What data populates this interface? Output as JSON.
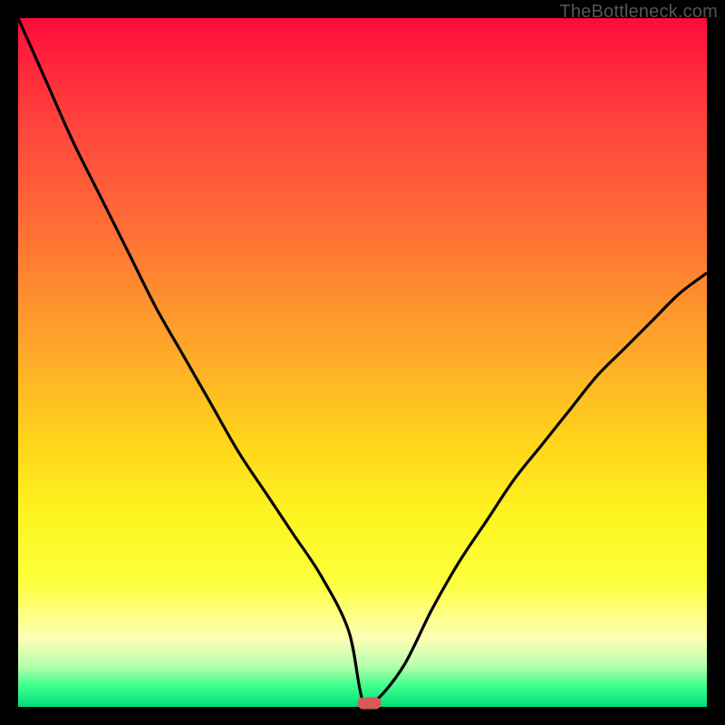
{
  "watermark": "TheBottleneck.com",
  "chart_data": {
    "type": "line",
    "title": "",
    "xlabel": "",
    "ylabel": "",
    "xlim": [
      0,
      100
    ],
    "ylim": [
      0,
      100
    ],
    "x": [
      0,
      4,
      8,
      12,
      16,
      20,
      24,
      28,
      32,
      36,
      40,
      44,
      48,
      50,
      52,
      56,
      60,
      64,
      68,
      72,
      76,
      80,
      84,
      88,
      92,
      96,
      100
    ],
    "y": [
      100,
      91,
      82,
      74,
      66,
      58,
      51,
      44,
      37,
      31,
      25,
      19,
      11,
      1,
      1,
      6,
      14,
      21,
      27,
      33,
      38,
      43,
      48,
      52,
      56,
      60,
      63
    ],
    "marker": {
      "x": 51,
      "y": 0,
      "color": "#d65a56"
    },
    "background_gradient": {
      "top": "#ff0a3a",
      "mid": "#ffd61a",
      "bottom": "#00dd77"
    }
  }
}
